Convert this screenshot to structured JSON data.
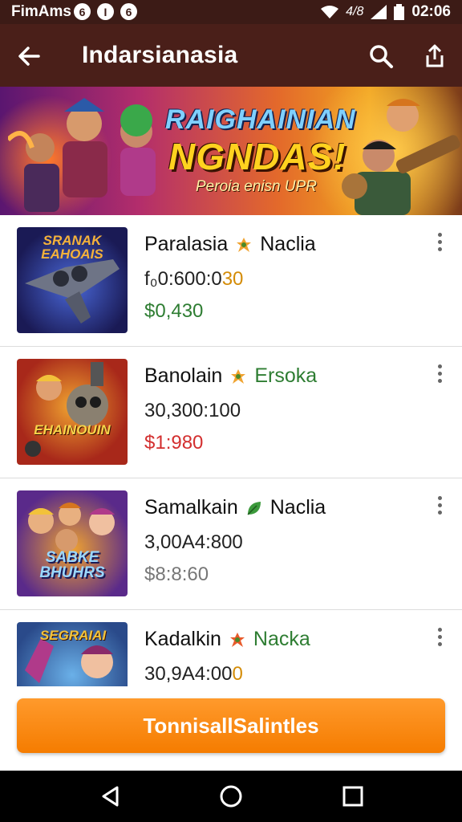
{
  "status_bar": {
    "carrier": "FimAms",
    "notifications": [
      "6",
      "I",
      "6"
    ],
    "time": "02:06",
    "signal_label": "4/8"
  },
  "app_bar": {
    "title": "Indarsianasia",
    "back_icon": "arrow-left-icon",
    "search_icon": "search-icon",
    "share_icon": "share-icon"
  },
  "banner": {
    "headline_1": "RAIGHAINIAN",
    "headline_2": "NGNDAS!",
    "subtitle": "Peroia enisn UPR"
  },
  "items": [
    {
      "name": "Paralasia",
      "tag": "Naclia",
      "tag_color": "#111111",
      "stat_prefix": "f₀0:600:0",
      "stat_highlight": "30",
      "price": "$0,430",
      "price_color": "#2e7d32",
      "thumb_title": "SRANAK EAHOAIS",
      "thumb_bg": "#2a2e7a"
    },
    {
      "name": "Banolain",
      "tag": "Ersoka",
      "tag_color": "#2e7d32",
      "stat_prefix": "30,300:100",
      "stat_highlight": "",
      "price": "$1:980",
      "price_color": "#d32f2f",
      "thumb_title": "EHAINOUIN",
      "thumb_bg": "#a8281a"
    },
    {
      "name": "Samalkain",
      "tag": "Naclia",
      "tag_color": "#111111",
      "stat_prefix": "3,00A4:800",
      "stat_highlight": "",
      "price": "$8:8:60",
      "price_color": "#777777",
      "thumb_title": "SABKE BHUHRS",
      "thumb_bg": "#5a2a8a"
    },
    {
      "name": "Kadalkin",
      "tag": "Nacka",
      "tag_color": "#2e7d32",
      "stat_prefix": "30,9A4:00",
      "stat_highlight": "0",
      "price": "",
      "price_color": "#777777",
      "thumb_title": "SEGRAIAI",
      "thumb_bg": "#3a6ab8"
    }
  ],
  "cta": {
    "label": "TonnisallSalintles"
  },
  "nav_bar": {
    "back_icon": "triangle-back-icon",
    "home_icon": "circle-home-icon",
    "recents_icon": "square-recents-icon"
  }
}
